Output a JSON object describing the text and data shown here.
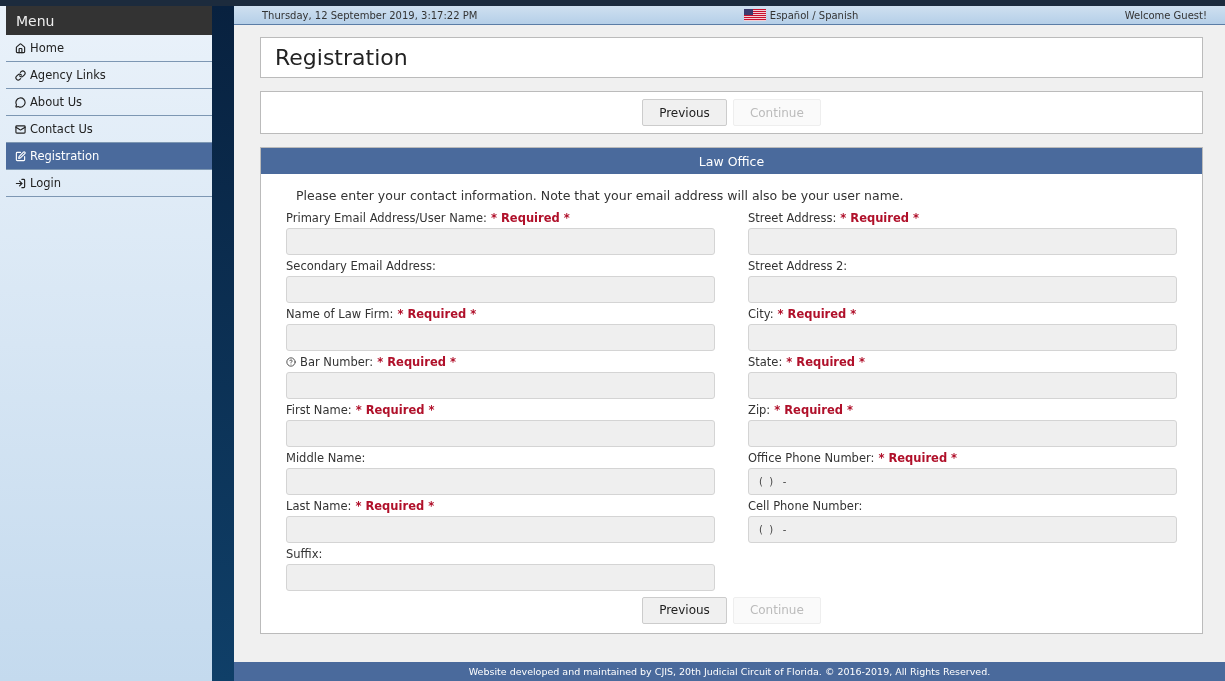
{
  "top_bar": {
    "date": "Thursday, 12 September 2019, 3:17:22 PM",
    "language": "Español / Spanish",
    "welcome": "Welcome Guest!"
  },
  "sidebar": {
    "title": "Menu",
    "items": [
      {
        "label": "Home",
        "selected": false
      },
      {
        "label": "Agency Links",
        "selected": false
      },
      {
        "label": "About Us",
        "selected": false
      },
      {
        "label": "Contact Us",
        "selected": false
      },
      {
        "label": "Registration",
        "selected": true
      },
      {
        "label": "Login",
        "selected": false
      }
    ]
  },
  "page_title": "Registration",
  "top_buttons": [
    {
      "label": "Previous",
      "disabled": false
    },
    {
      "label": "Continue",
      "disabled": true
    }
  ],
  "panel": {
    "title": "Law Office",
    "intro": "Please enter your contact information. Note that your email address will also be your user name.",
    "columns": [
      [
        {
          "label": "Primary Email Address/User Name:",
          "required": "* Required *"
        },
        {
          "label": "Secondary Email Address:"
        },
        {
          "label": "Name of Law Firm:",
          "required": "* Required *"
        },
        {
          "label": "Bar Number:",
          "required": "* Required *",
          "help": true
        },
        {
          "label": "First Name:",
          "required": "* Required *"
        },
        {
          "label": "Middle Name:"
        },
        {
          "label": "Last Name:",
          "required": "* Required *"
        },
        {
          "label": "Suffix:"
        }
      ],
      [
        {
          "label": "Street Address:",
          "required": "* Required *"
        },
        {
          "label": "Street Address 2:"
        },
        {
          "label": "City:",
          "required": "* Required *"
        },
        {
          "label": "State:",
          "required": "* Required *"
        },
        {
          "label": "Zip:",
          "required": "* Required *"
        },
        {
          "label": "Office Phone Number:",
          "required": "* Required *",
          "value": "(  )   -"
        },
        {
          "label": "Cell Phone Number:",
          "value": "(  )   -"
        }
      ]
    ]
  },
  "bottom_buttons": [
    {
      "label": "Previous",
      "disabled": false
    },
    {
      "label": "Continue",
      "disabled": true
    }
  ],
  "footer": "Website developed and maintained by CJIS, 20th Judicial Circuit of Florida. © 2016-2019, All Rights Reserved."
}
